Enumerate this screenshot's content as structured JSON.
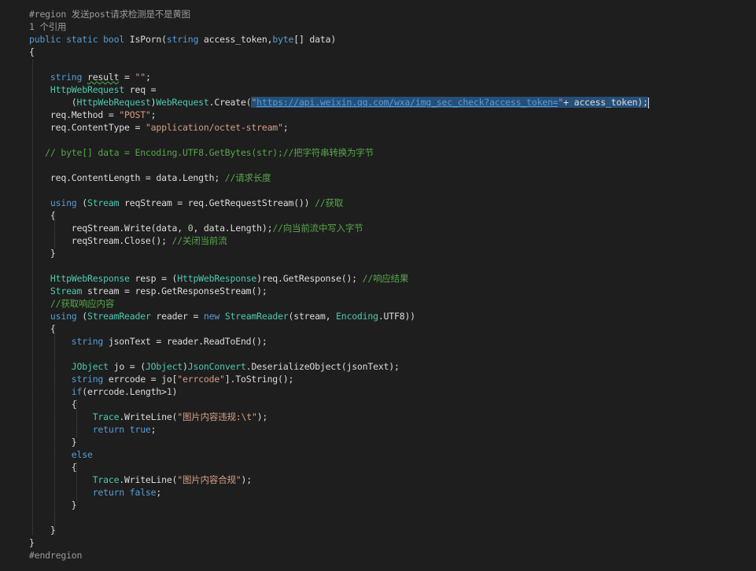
{
  "editor": {
    "region_start": "#region 发送post请求检测是不是黄图",
    "codelens": "1 个引用",
    "lines": [
      {
        "indent": "public ",
        "parts": [
          {
            "t": "public",
            "c": "kw"
          },
          {
            "t": " "
          },
          {
            "t": "static",
            "c": "kw"
          },
          {
            "t": " "
          },
          {
            "t": "bool",
            "c": "kw"
          },
          {
            "t": " IsPorn("
          },
          {
            "t": "string",
            "c": "kw"
          },
          {
            "t": " access_token,"
          },
          {
            "t": "byte",
            "c": "kw"
          },
          {
            "t": "[] data)"
          }
        ]
      },
      {
        "parts": [
          {
            "t": "{"
          }
        ]
      },
      {
        "parts": []
      },
      {
        "parts": [
          {
            "t": "    "
          },
          {
            "t": "string",
            "c": "kw"
          },
          {
            "t": " "
          },
          {
            "t": "result",
            "c": "squiggle"
          },
          {
            "t": " = "
          },
          {
            "t": "\"\"",
            "c": "st"
          },
          {
            "t": ";"
          }
        ]
      },
      {
        "parts": [
          {
            "t": "    "
          },
          {
            "t": "HttpWebRequest",
            "c": "ty"
          },
          {
            "t": " req ="
          }
        ]
      },
      {
        "parts": [
          {
            "t": "        ("
          },
          {
            "t": "HttpWebRequest",
            "c": "ty"
          },
          {
            "t": ")"
          },
          {
            "t": "WebRequest",
            "c": "ty"
          },
          {
            "t": ".Create("
          },
          {
            "t": "\"",
            "c": "st sel"
          },
          {
            "t": "https://api.weixin.qq.com/wxa/img_sec_check?access_token=",
            "c": "link sel"
          },
          {
            "t": "\"",
            "c": "st sel"
          },
          {
            "t": "+ access_token);",
            "c": "sel"
          },
          {
            "t": "",
            "c": "caret"
          }
        ]
      },
      {
        "parts": [
          {
            "t": "    req.Method = "
          },
          {
            "t": "\"POST\"",
            "c": "st"
          },
          {
            "t": ";"
          }
        ]
      },
      {
        "parts": [
          {
            "t": "    req.ContentType = "
          },
          {
            "t": "\"application/octet-stream\"",
            "c": "st"
          },
          {
            "t": ";"
          }
        ]
      },
      {
        "parts": []
      },
      {
        "parts": [
          {
            "t": "   "
          },
          {
            "t": "// byte[] data = Encoding.UTF8.GetBytes(str);//把字符串转换为字节",
            "c": "cm"
          }
        ]
      },
      {
        "parts": []
      },
      {
        "parts": [
          {
            "t": "    req.ContentLength = data.Length; "
          },
          {
            "t": "//请求长度",
            "c": "cm"
          }
        ]
      },
      {
        "parts": []
      },
      {
        "parts": [
          {
            "t": "    "
          },
          {
            "t": "using",
            "c": "kw"
          },
          {
            "t": " ("
          },
          {
            "t": "Stream",
            "c": "ty"
          },
          {
            "t": " reqStream = req.GetRequestStream()) "
          },
          {
            "t": "//获取",
            "c": "cm"
          }
        ]
      },
      {
        "parts": [
          {
            "t": "    {"
          }
        ]
      },
      {
        "parts": [
          {
            "t": "        reqStream.Write(data, "
          },
          {
            "t": "0",
            "c": "nm"
          },
          {
            "t": ", data.Length);"
          },
          {
            "t": "//向当前流中写入字节",
            "c": "cm"
          }
        ]
      },
      {
        "parts": [
          {
            "t": "        reqStream.Close(); "
          },
          {
            "t": "//关闭当前流",
            "c": "cm"
          }
        ]
      },
      {
        "parts": [
          {
            "t": "    }"
          }
        ]
      },
      {
        "parts": []
      },
      {
        "parts": [
          {
            "t": "    "
          },
          {
            "t": "HttpWebResponse",
            "c": "ty"
          },
          {
            "t": " resp = ("
          },
          {
            "t": "HttpWebResponse",
            "c": "ty"
          },
          {
            "t": ")req.GetResponse(); "
          },
          {
            "t": "//响应结果",
            "c": "cm"
          }
        ]
      },
      {
        "parts": [
          {
            "t": "    "
          },
          {
            "t": "Stream",
            "c": "ty"
          },
          {
            "t": " stream = resp.GetResponseStream();"
          }
        ]
      },
      {
        "parts": [
          {
            "t": "    "
          },
          {
            "t": "//获取响应内容",
            "c": "cm"
          }
        ]
      },
      {
        "parts": [
          {
            "t": "    "
          },
          {
            "t": "using",
            "c": "kw"
          },
          {
            "t": " ("
          },
          {
            "t": "StreamReader",
            "c": "ty"
          },
          {
            "t": " reader = "
          },
          {
            "t": "new",
            "c": "kw"
          },
          {
            "t": " "
          },
          {
            "t": "StreamReader",
            "c": "ty"
          },
          {
            "t": "(stream, "
          },
          {
            "t": "Encoding",
            "c": "ty"
          },
          {
            "t": ".UTF8))"
          }
        ]
      },
      {
        "parts": [
          {
            "t": "    {"
          }
        ]
      },
      {
        "parts": [
          {
            "t": "        "
          },
          {
            "t": "string",
            "c": "kw"
          },
          {
            "t": " jsonText = reader.ReadToEnd();"
          }
        ]
      },
      {
        "parts": []
      },
      {
        "parts": [
          {
            "t": "        "
          },
          {
            "t": "JObject",
            "c": "ty"
          },
          {
            "t": " jo = ("
          },
          {
            "t": "JObject",
            "c": "ty"
          },
          {
            "t": ")"
          },
          {
            "t": "JsonConvert",
            "c": "ty"
          },
          {
            "t": ".DeserializeObject(jsonText);"
          }
        ]
      },
      {
        "parts": [
          {
            "t": "        "
          },
          {
            "t": "string",
            "c": "kw"
          },
          {
            "t": " errcode = jo["
          },
          {
            "t": "\"errcode\"",
            "c": "st"
          },
          {
            "t": "].ToString();"
          }
        ]
      },
      {
        "parts": [
          {
            "t": "        "
          },
          {
            "t": "if",
            "c": "kw"
          },
          {
            "t": "(errcode.Length>"
          },
          {
            "t": "1",
            "c": "nm"
          },
          {
            "t": ")"
          }
        ]
      },
      {
        "parts": [
          {
            "t": "        {"
          }
        ]
      },
      {
        "parts": [
          {
            "t": "            "
          },
          {
            "t": "Trace",
            "c": "ty"
          },
          {
            "t": ".WriteLine("
          },
          {
            "t": "\"图片内容违规:\\t\"",
            "c": "st"
          },
          {
            "t": ");"
          }
        ]
      },
      {
        "parts": [
          {
            "t": "            "
          },
          {
            "t": "return",
            "c": "kw"
          },
          {
            "t": " "
          },
          {
            "t": "true",
            "c": "kw"
          },
          {
            "t": ";"
          }
        ]
      },
      {
        "parts": [
          {
            "t": "        }"
          }
        ]
      },
      {
        "parts": [
          {
            "t": "        "
          },
          {
            "t": "else",
            "c": "kw"
          }
        ]
      },
      {
        "parts": [
          {
            "t": "        {"
          }
        ]
      },
      {
        "parts": [
          {
            "t": "            "
          },
          {
            "t": "Trace",
            "c": "ty"
          },
          {
            "t": ".WriteLine("
          },
          {
            "t": "\"图片内容合规\"",
            "c": "st"
          },
          {
            "t": ");"
          }
        ]
      },
      {
        "parts": [
          {
            "t": "            "
          },
          {
            "t": "return",
            "c": "kw"
          },
          {
            "t": " "
          },
          {
            "t": "false",
            "c": "kw"
          },
          {
            "t": ";"
          }
        ]
      },
      {
        "parts": [
          {
            "t": "        }"
          }
        ]
      },
      {
        "parts": []
      },
      {
        "parts": [
          {
            "t": "    }"
          }
        ]
      },
      {
        "parts": [
          {
            "t": "}"
          }
        ]
      }
    ],
    "region_end": "#endregion"
  }
}
